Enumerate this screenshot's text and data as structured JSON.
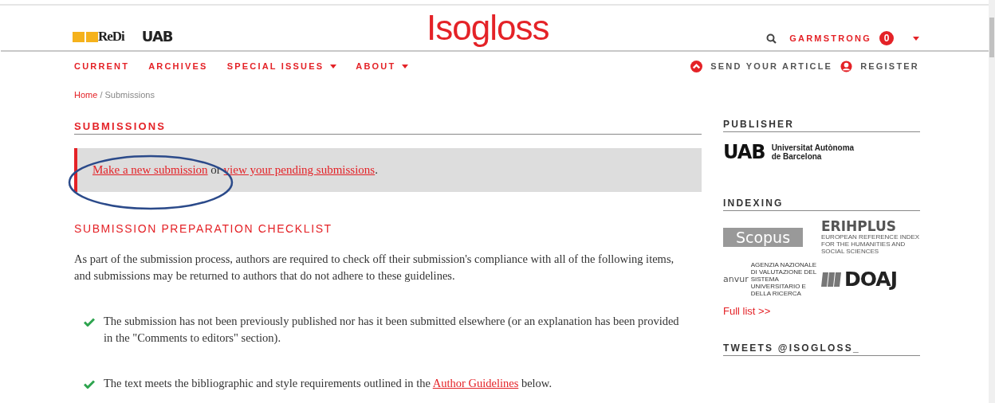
{
  "header": {
    "logos": [
      {
        "kind": "redi",
        "text": "ReDi"
      },
      {
        "kind": "uab",
        "text": "UAB"
      }
    ],
    "title": "Isogloss",
    "user": "GARMSTRONG",
    "notification_count": "0"
  },
  "nav": {
    "items": [
      {
        "label": "CURRENT",
        "dropdown": false
      },
      {
        "label": "ARCHIVES",
        "dropdown": false
      },
      {
        "label": "SPECIAL ISSUES",
        "dropdown": true
      },
      {
        "label": "ABOUT",
        "dropdown": true
      }
    ],
    "actions": [
      {
        "kind": "send",
        "label": "SEND YOUR ARTICLE"
      },
      {
        "kind": "register",
        "label": "REGISTER"
      }
    ]
  },
  "breadcrumb": {
    "items": [
      "Home",
      "Submissions"
    ],
    "separator": "/"
  },
  "main": {
    "title": "SUBMISSIONS",
    "notice": {
      "link_1": "Make a new submission",
      "middle": "or",
      "link_2": "view your pending submissions",
      "end": "."
    },
    "checklist_title": "SUBMISSION PREPARATION CHECKLIST",
    "intro": "As part of the submission process, authors are required to check off their submission's compliance with all of the following items, and submissions may be returned to authors that do not adhere to these guidelines.",
    "checklist": [
      {
        "checked": true,
        "text": "The submission has not been previously published nor has it been submitted elsewhere (or an explanation has been provided in the \"Comments to editors\" section)."
      },
      {
        "checked": true,
        "text": "The text meets the bibliographic and style requirements outlined in the",
        "link": "Author Guidelines",
        "after": "below."
      }
    ]
  },
  "sidebar": {
    "publisher": {
      "title": "PUBLISHER",
      "logo_mark": "UAB",
      "logo_lines": [
        "Universitat Autònoma",
        "de Barcelona"
      ]
    },
    "indexing": {
      "title": "INDEXING",
      "logos": [
        {
          "kind": "scopus",
          "name": "Scopus"
        },
        {
          "kind": "erihplus",
          "name": "ERIHPLUS",
          "subtitle": "EUROPEAN REFERENCE INDEX FOR THE HUMANITIES AND SOCIAL SCIENCES"
        },
        {
          "kind": "anvur",
          "name": "anvur",
          "subtitle": "AGENZIA NAZIONALE DI VALUTAZIONE DEL SISTEMA UNIVERSITARIO E DELLA RICERCA"
        },
        {
          "kind": "doaj",
          "name": "DOAJ"
        }
      ],
      "link": "Full list >>"
    },
    "tweets": {
      "title": "TWEETS @ISOGLOSS_"
    }
  }
}
